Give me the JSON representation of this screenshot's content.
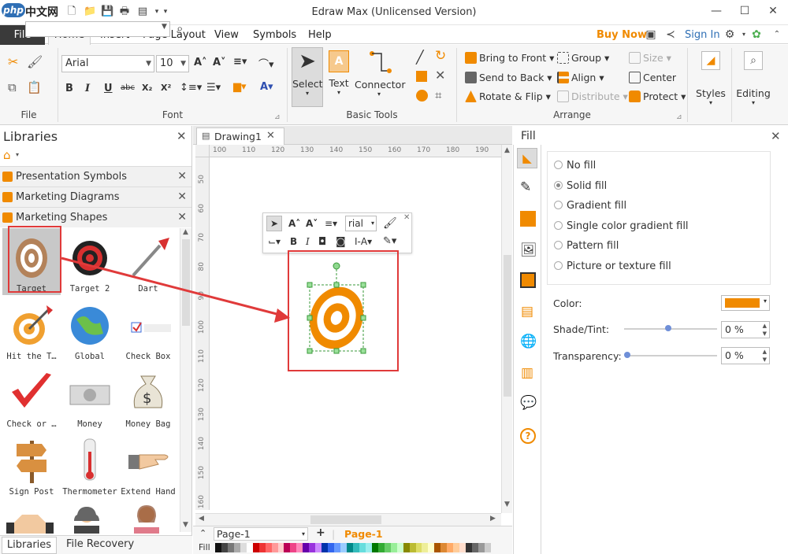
{
  "window": {
    "logo_text": "php",
    "logo_cn": "中文网",
    "title": "Edraw Max (Unlicensed Version)"
  },
  "menu": {
    "file": "File",
    "tabs": [
      "Home",
      "Insert",
      "Page Layout",
      "View",
      "Symbols",
      "Help"
    ],
    "buy_now": "Buy Now",
    "sign_in": "Sign In"
  },
  "ribbon": {
    "file_group": "File",
    "font_group": "Font",
    "font_name": "Arial",
    "font_size": "10",
    "basic_tools_group": "Basic Tools",
    "select": "Select",
    "text": "Text",
    "connector": "Connector",
    "arrange_group": "Arrange",
    "bring_to_front": "Bring to Front",
    "send_to_back": "Send to Back",
    "rotate_flip": "Rotate & Flip",
    "group": "Group",
    "align": "Align",
    "distribute": "Distribute",
    "size": "Size",
    "center": "Center",
    "protect": "Protect",
    "styles": "Styles",
    "editing": "Editing"
  },
  "libraries": {
    "title": "Libraries",
    "sections": [
      "Presentation Symbols",
      "Marketing Diagrams",
      "Marketing Shapes"
    ],
    "shapes": [
      {
        "label": "Target"
      },
      {
        "label": "Target 2"
      },
      {
        "label": "Dart"
      },
      {
        "label": "Hit the T…"
      },
      {
        "label": "Global"
      },
      {
        "label": "Check Box"
      },
      {
        "label": "Check or …"
      },
      {
        "label": "Money"
      },
      {
        "label": "Money Bag"
      },
      {
        "label": "Sign Post"
      },
      {
        "label": "Thermometer"
      },
      {
        "label": "Extend Hand"
      }
    ],
    "footer_tabs": [
      "Libraries",
      "File Recovery"
    ]
  },
  "document": {
    "tab": "Drawing1",
    "ruler_h": [
      "100",
      "110",
      "120",
      "130",
      "140",
      "150",
      "160",
      "170",
      "180",
      "190"
    ],
    "ruler_v": [
      "50",
      "60",
      "70",
      "80",
      "90",
      "100",
      "110",
      "120",
      "130",
      "140",
      "150",
      "160"
    ],
    "page_select": "Page-1",
    "page_tab": "Page-1",
    "fill_label": "Fill",
    "mini_font": "rial"
  },
  "fill_panel": {
    "title": "Fill",
    "options": [
      "No fill",
      "Solid fill",
      "Gradient fill",
      "Single color gradient fill",
      "Pattern fill",
      "Picture or texture fill"
    ],
    "selected_index": 1,
    "color_label": "Color:",
    "shade_label": "Shade/Tint:",
    "shade_value": "0 %",
    "transparency_label": "Transparency:",
    "transparency_value": "0 %",
    "color": "#f08a00"
  },
  "colors": {
    "accent": "#f08a00",
    "annotation": "#e03a3a",
    "link": "#2f6fb5"
  }
}
